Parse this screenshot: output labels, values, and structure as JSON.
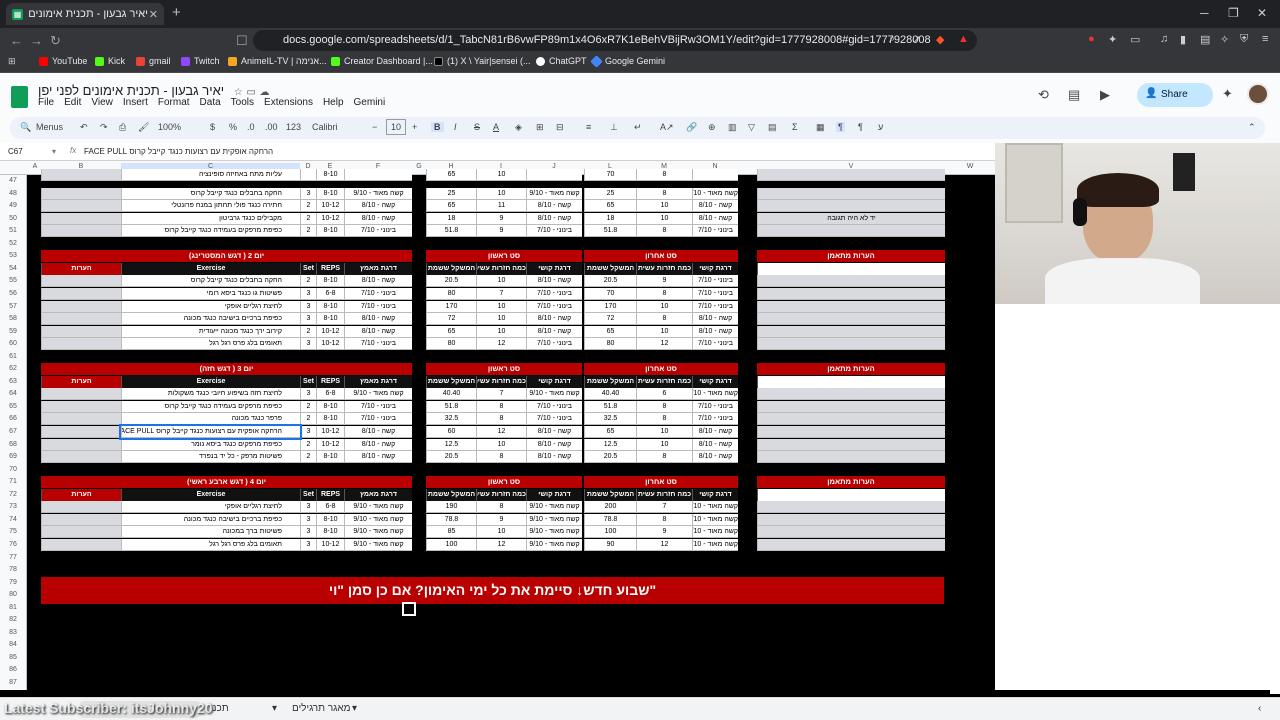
{
  "browser": {
    "tab_title": "יאיר גבעון - תכנית אימונים לפני י",
    "url": "docs.google.com/spreadsheets/d/1_TabcN81rB6vwFP89m1x4O6xR7K1eBehVBijRw3OM1Y/edit?gid=1777928008#gid=1777928008",
    "bookmarks": [
      {
        "label": "YouTube",
        "color": "#ff0000"
      },
      {
        "label": "Kick",
        "color": "#53fc18"
      },
      {
        "label": "gmail",
        "color": "#ea4335"
      },
      {
        "label": "Twitch",
        "color": "#9146ff"
      },
      {
        "label": "AnimeIL-TV | אנימה...",
        "color": "#f5a623"
      },
      {
        "label": "Creator Dashboard |...",
        "color": "#53fc18"
      },
      {
        "label": "(1) X \\ Yair|sensei (...",
        "color": "#000000"
      },
      {
        "label": "ChatGPT",
        "color": "#ffffff"
      },
      {
        "label": "Google Gemini",
        "color": "#4285f4"
      }
    ]
  },
  "sheets": {
    "doc_title": "יאיר גבעון - תכנית אימונים לפני יפן",
    "menus": [
      "File",
      "Edit",
      "View",
      "Insert",
      "Format",
      "Data",
      "Tools",
      "Extensions",
      "Help",
      "Gemini"
    ],
    "share_label": "Share",
    "toolbar": {
      "menus": "Menus",
      "zoom": "100%",
      "currency": "$",
      "percent": "%",
      "dec_less": ".0",
      "dec_more": ".00",
      "number_fmt": "123",
      "font": "Calibri",
      "font_size": "10",
      "bold": "B",
      "italic": "I",
      "strike": "S",
      "text_color": "A"
    },
    "name_box": "C67",
    "formula": "הרחקה אופקית עם רצועות כנגד קייבל קרוס FACE PULL",
    "columns": [
      "A",
      "B",
      "C",
      "D",
      "E",
      "F",
      "G",
      "H",
      "I",
      "J",
      "L",
      "M",
      "N",
      "V",
      "W"
    ]
  },
  "grid": {
    "top_rows": [
      {
        "row": "48",
        "ex": "החקה בחבלים כנגד קייבל קרוס",
        "set": "3",
        "reps": "8-10",
        "diff": "קשה מאוד - 9/10",
        "w1": "25",
        "r1": "10",
        "d1": "קשה מאוד - 9/10",
        "w2": "25",
        "r2": "8",
        "d2": "קשה מאוד - 9/10"
      },
      {
        "row": "49",
        "ex": "חתירה כנגד פולי תחתון במנח פרונטלי",
        "set": "2",
        "reps": "10-12",
        "diff": "קשה - 8/10",
        "w1": "65",
        "r1": "11",
        "d1": "קשה - 8/10",
        "w2": "65",
        "r2": "10",
        "d2": "קשה - 8/10"
      },
      {
        "row": "50",
        "ex": "מקבילים כנגד גרביטון",
        "set": "2",
        "reps": "10-12",
        "diff": "קשה - 8/10",
        "w1": "18",
        "r1": "9",
        "d1": "קשה - 8/10",
        "w2": "18",
        "r2": "10",
        "d2": "קשה - 8/10",
        "note": "יד לא היה תגובה"
      },
      {
        "row": "51",
        "ex": "כפיפת מרפקים בעמידה כנגד קייבל קרוס",
        "set": "2",
        "reps": "8-10",
        "diff": "בינוני - 7/10",
        "w1": "51.8",
        "r1": "9",
        "d1": "בינוני - 7/10",
        "w2": "51.8",
        "r2": "8",
        "d2": "בינוני - 7/10"
      }
    ],
    "headers": {
      "exercise": "Exercise",
      "set": "Set",
      "reps": "REPS",
      "target_diff": "דרגת מאמץ",
      "notes": "הערות",
      "weight": "המשקל ששמת",
      "reps_done": "כמה חזרות עשית",
      "diff": "דרגת קושי",
      "first_set": "סט ראשון",
      "last_set": "סט אחרון",
      "trainer_notes": "הערות מתאמן"
    },
    "days": [
      {
        "title": "יום 2 ( דגש המסטרינג)",
        "rows": [
          {
            "row": "55",
            "ex": "החקה בחבלים כנגד קייבל קרוס",
            "set": "2",
            "reps": "8-10",
            "diff": "קשה - 8/10",
            "w1": "20.5",
            "r1": "10",
            "d1": "קשה - 8/10",
            "w2": "20.5",
            "r2": "9",
            "d2": "בינוני - 7/10"
          },
          {
            "row": "56",
            "ex": "פשיטות גו כנגד ביסא רומי",
            "set": "3",
            "reps": "6-8",
            "diff": "בינוני - 7/10",
            "w1": "80",
            "r1": "7",
            "d1": "בינוני - 7/10",
            "w2": "70",
            "r2": "8",
            "d2": "בינוני - 7/10"
          },
          {
            "row": "57",
            "ex": "לחיצת רגליים אופקי",
            "set": "3",
            "reps": "8-10",
            "diff": "בינוני - 7/10",
            "w1": "170",
            "r1": "10",
            "d1": "בינוני - 7/10",
            "w2": "170",
            "r2": "10",
            "d2": "בינוני - 7/10"
          },
          {
            "row": "58",
            "ex": "כפיפת ברכיים בישיבה כנגד מכונה",
            "set": "3",
            "reps": "8-10",
            "diff": "קשה - 8/10",
            "w1": "72",
            "r1": "10",
            "d1": "קשה - 8/10",
            "w2": "72",
            "r2": "8",
            "d2": "קשה - 8/10"
          },
          {
            "row": "59",
            "ex": "קירוב ירך כנגד מכונה ייעודית",
            "set": "2",
            "reps": "10-12",
            "diff": "קשה - 8/10",
            "w1": "65",
            "r1": "10",
            "d1": "קשה - 8/10",
            "w2": "65",
            "r2": "10",
            "d2": "קשה - 8/10"
          },
          {
            "row": "60",
            "ex": "תאומים בלג פרס רגל רגל",
            "set": "3",
            "reps": "10-12",
            "diff": "בינוני - 7/10",
            "w1": "80",
            "r1": "12",
            "d1": "בינוני - 7/10",
            "w2": "80",
            "r2": "12",
            "d2": "בינוני - 7/10"
          }
        ]
      },
      {
        "title": "יום 3 ( דגש חזה)",
        "rows": [
          {
            "row": "64",
            "ex": "לחיצת חזה בשיפוע חיובי כנגד משקולות",
            "set": "3",
            "reps": "6-8",
            "diff": "קשה מאוד - 9/10",
            "w1": "40.40",
            "r1": "7",
            "d1": "קשה מאוד - 9/10",
            "w2": "40.40",
            "r2": "6",
            "d2": "קשה מאוד - 9/10"
          },
          {
            "row": "65",
            "ex": "כפיפת מרפקים בעמידה כנגד קייבל קרוס",
            "set": "2",
            "reps": "8-10",
            "diff": "בינוני - 7/10",
            "w1": "51.8",
            "r1": "8",
            "d1": "בינוני - 7/10",
            "w2": "51.8",
            "r2": "8",
            "d2": "בינוני - 7/10"
          },
          {
            "row": "66",
            "ex": "פרפר כנגד מכונה",
            "set": "2",
            "reps": "8-10",
            "diff": "בינוני - 7/10",
            "w1": "32.5",
            "r1": "8",
            "d1": "בינוני - 7/10",
            "w2": "32.5",
            "r2": "8",
            "d2": "בינוני - 7/10"
          },
          {
            "row": "67",
            "ex": "הרחקה אופקית עם רצועות כנגד קייבל קרוס FACE PULL",
            "set": "3",
            "reps": "10-12",
            "diff": "קשה - 8/10",
            "w1": "60",
            "r1": "12",
            "d1": "קשה - 8/10",
            "w2": "65",
            "r2": "10",
            "d2": "קשה - 8/10",
            "selected": true
          },
          {
            "row": "68",
            "ex": "כפיפת מרפקים כנגד ביסא נומר",
            "set": "2",
            "reps": "10-12",
            "diff": "קשה - 8/10",
            "w1": "12.5",
            "r1": "10",
            "d1": "קשה - 8/10",
            "w2": "12.5",
            "r2": "10",
            "d2": "קשה - 8/10"
          },
          {
            "row": "69",
            "ex": "פשיטות מרפק - כל יד בנפרד",
            "set": "2",
            "reps": "8-10",
            "diff": "קשה - 8/10",
            "w1": "20.5",
            "r1": "8",
            "d1": "קשה - 8/10",
            "w2": "20.5",
            "r2": "8",
            "d2": "קשה - 8/10"
          }
        ]
      },
      {
        "title": "יום 4 ( דגש ארבע ראשי)",
        "rows": [
          {
            "row": "73",
            "ex": "לחיצת רגליים אופקי",
            "set": "3",
            "reps": "6-8",
            "diff": "קשה מאוד - 9/10",
            "w1": "190",
            "r1": "8",
            "d1": "קשה מאוד - 9/10",
            "w2": "200",
            "r2": "7",
            "d2": "קשה מאוד - 9/10"
          },
          {
            "row": "74",
            "ex": "כפיפת ברכיים בישיבה כנגד מכונה",
            "set": "3",
            "reps": "8-10",
            "diff": "קשה מאוד - 9/10",
            "w1": "78.8",
            "r1": "9",
            "d1": "קשה מאוד - 9/10",
            "w2": "78.8",
            "r2": "8",
            "d2": "קשה מאוד - 9/10"
          },
          {
            "row": "75",
            "ex": "פשיטות ברך במכונה",
            "set": "3",
            "reps": "8-10",
            "diff": "קשה מאוד - 9/10",
            "w1": "85",
            "r1": "10",
            "d1": "קשה מאוד - 9/10",
            "w2": "100",
            "r2": "9",
            "d2": "קשה מאוד - 9/10"
          },
          {
            "row": "76",
            "ex": "תאומים בלג פרס רגל רגל",
            "set": "3",
            "reps": "10-12",
            "diff": "קשה מאוד - 9/10",
            "w1": "100",
            "r1": "12",
            "d1": "קשה מאוד - 9/10",
            "w2": "90",
            "r2": "12",
            "d2": "קשה מאוד - 9/10"
          }
        ]
      }
    ],
    "banner": "שבוע חדש↓ סיימת את כל ימי האימון? אם כן סמן \"וי\"",
    "row_numbers": [
      "47",
      "48",
      "49",
      "50",
      "51",
      "52",
      "53",
      "54",
      "55",
      "56",
      "57",
      "58",
      "59",
      "60",
      "61",
      "62",
      "63",
      "64",
      "65",
      "66",
      "67",
      "68",
      "69",
      "70",
      "71",
      "72",
      "73",
      "74",
      "75",
      "76",
      "77",
      "78",
      "79",
      "80",
      "81",
      "82",
      "83",
      "84",
      "85",
      "86",
      "87"
    ]
  },
  "sheet_tabs": {
    "tab1": "Latest Subscriber: itsJohnny20",
    "tab2": "תכני",
    "tab3": "מאגר תרגילים"
  },
  "overlay": "Latest Subscriber: itsJohnny20"
}
